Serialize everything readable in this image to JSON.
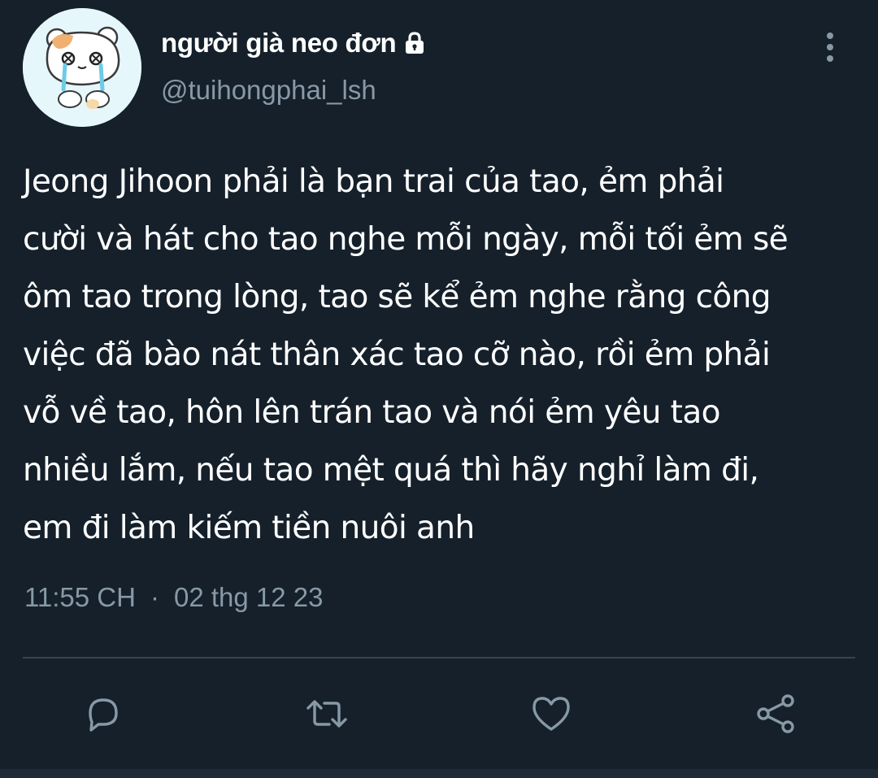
{
  "user": {
    "display_name": "người già neo đơn",
    "handle": "@tuihongphai_lsh",
    "protected_icon": "lock-icon",
    "avatar_icon": "crying-bear-avatar"
  },
  "tweet": {
    "text_lines": [
      "Jeong Jihoon phải là bạn trai của tao, ẻm phải",
      "cười và hát cho tao nghe mỗi ngày, mỗi tối ẻm sẽ",
      "ôm tao trong lòng, tao sẽ kể ẻm nghe rằng công",
      "việc đã bào nát thân xác tao cỡ nào, rồi ẻm phải",
      "vỗ về tao, hôn lên trán tao và nói ẻm yêu tao",
      "nhiều lắm, nếu tao mệt quá thì hãy nghỉ làm đi,",
      "em đi làm kiếm tiền nuôi anh"
    ],
    "time": "11:55 CH",
    "separator": "·",
    "date": "02 thg 12 23"
  },
  "actions": {
    "reply_icon": "reply-icon",
    "retweet_icon": "retweet-icon",
    "like_icon": "heart-icon",
    "share_icon": "share-icon",
    "more_icon": "more-vertical-icon"
  },
  "colors": {
    "background": "#15202b",
    "text_primary": "#ffffff",
    "text_secondary": "#8899a6",
    "divider": "#38444d"
  }
}
